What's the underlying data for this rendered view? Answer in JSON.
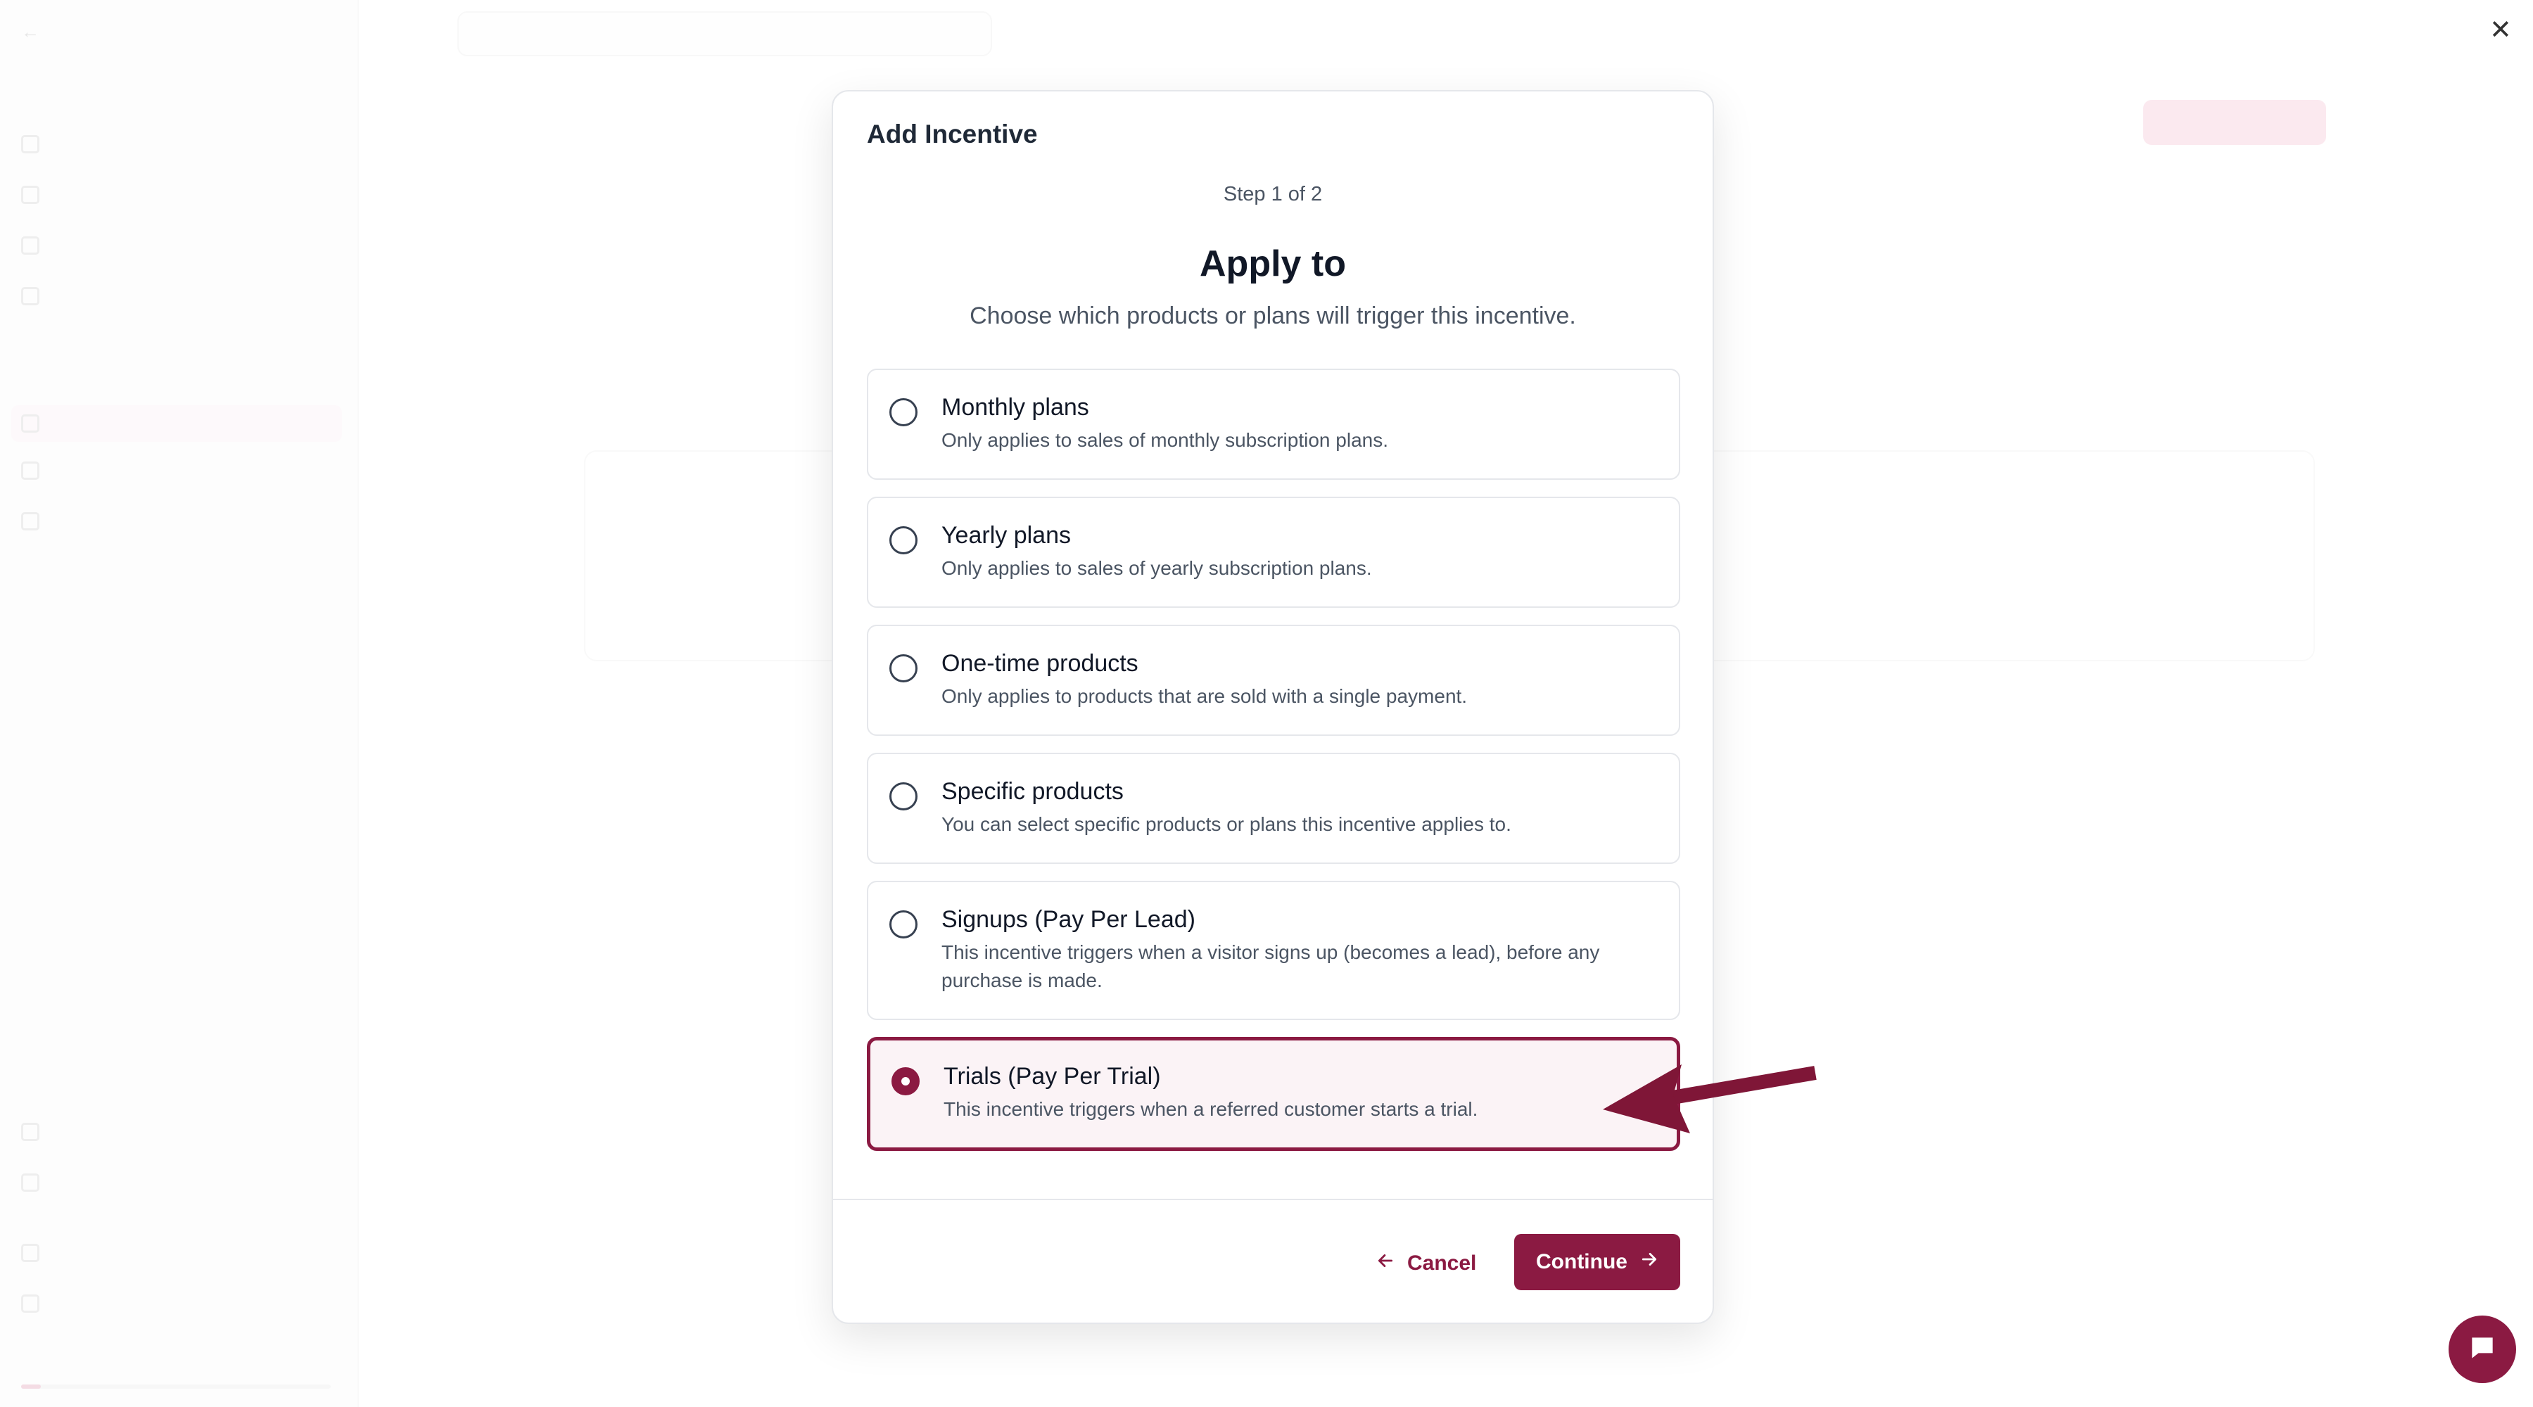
{
  "modal": {
    "title": "Add Incentive",
    "step": "Step 1 of 2",
    "heading": "Apply to",
    "subheading": "Choose which products or plans will trigger this incentive.",
    "options": [
      {
        "label": "Monthly plans",
        "description": "Only applies to sales of monthly subscription plans.",
        "selected": false
      },
      {
        "label": "Yearly plans",
        "description": "Only applies to sales of yearly subscription plans.",
        "selected": false
      },
      {
        "label": "One-time products",
        "description": "Only applies to products that are sold with a single payment.",
        "selected": false
      },
      {
        "label": "Specific products",
        "description": "You can select specific products or plans this incentive applies to.",
        "selected": false
      },
      {
        "label": "Signups (Pay Per Lead)",
        "description": "This incentive triggers when a visitor signs up (becomes a lead), before any purchase is made.",
        "selected": false
      },
      {
        "label": "Trials (Pay Per Trial)",
        "description": "This incentive triggers when a referred customer starts a trial.",
        "selected": true
      }
    ],
    "cancel_label": "Cancel",
    "continue_label": "Continue"
  },
  "colors": {
    "accent": "#8b1a42",
    "selected_bg": "#fbf3f6",
    "border": "#e5e7eb"
  },
  "icons": {
    "close": "close-icon",
    "cancel": "arrow-left-icon",
    "continue": "arrow-right-icon",
    "chat": "chat-icon",
    "annotation": "annotation-arrow-icon"
  }
}
